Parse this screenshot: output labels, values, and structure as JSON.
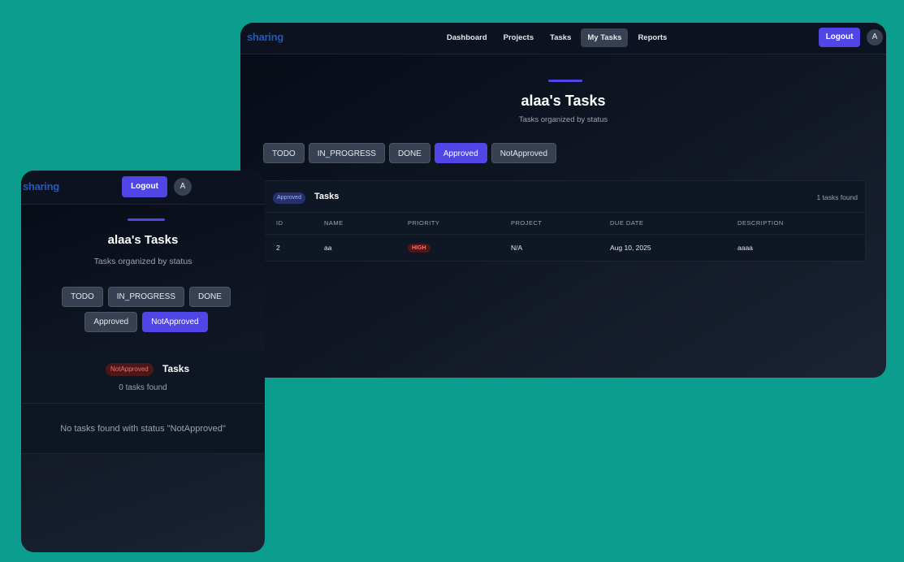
{
  "brand": {
    "logo_main": "sharing",
    "logo_sub": ""
  },
  "desktop": {
    "nav": {
      "links": [
        {
          "label": "Dashboard"
        },
        {
          "label": "Projects"
        },
        {
          "label": "Tasks"
        },
        {
          "label": "My Tasks",
          "active": true
        },
        {
          "label": "Reports"
        }
      ],
      "logout_label": "Logout",
      "avatar_initial": "A"
    },
    "title": "alaa's Tasks",
    "subtitle": "Tasks organized by status",
    "filters": [
      "TODO",
      "IN_PROGRESS",
      "DONE",
      "Approved",
      "NotApproved"
    ],
    "active_filter": "Approved",
    "panel": {
      "status_pill": "Approved",
      "title": "Tasks",
      "count_text": "1 tasks found",
      "columns": [
        "ID",
        "NAME",
        "PRIORITY",
        "PROJECT",
        "DUE DATE",
        "DESCRIPTION"
      ],
      "rows": [
        {
          "id": "2",
          "name": "aa",
          "priority": "HIGH",
          "project": "N/A",
          "due_date": "Aug 10, 2025",
          "description": "aaaa"
        }
      ]
    }
  },
  "mobile": {
    "logout_label": "Logout",
    "avatar_initial": "A",
    "title": "alaa's Tasks",
    "subtitle": "Tasks organized by status",
    "filters": [
      "TODO",
      "IN_PROGRESS",
      "DONE",
      "Approved",
      "NotApproved"
    ],
    "active_filter": "NotApproved",
    "section": {
      "status_pill": "NotApproved",
      "title": "Tasks",
      "count_text": "0 tasks found",
      "empty_text": "No tasks found with status \"NotApproved\""
    }
  },
  "colors": {
    "background": "#0b9e8e",
    "accent": "#4f46e5",
    "priority_high": "#f87171"
  }
}
